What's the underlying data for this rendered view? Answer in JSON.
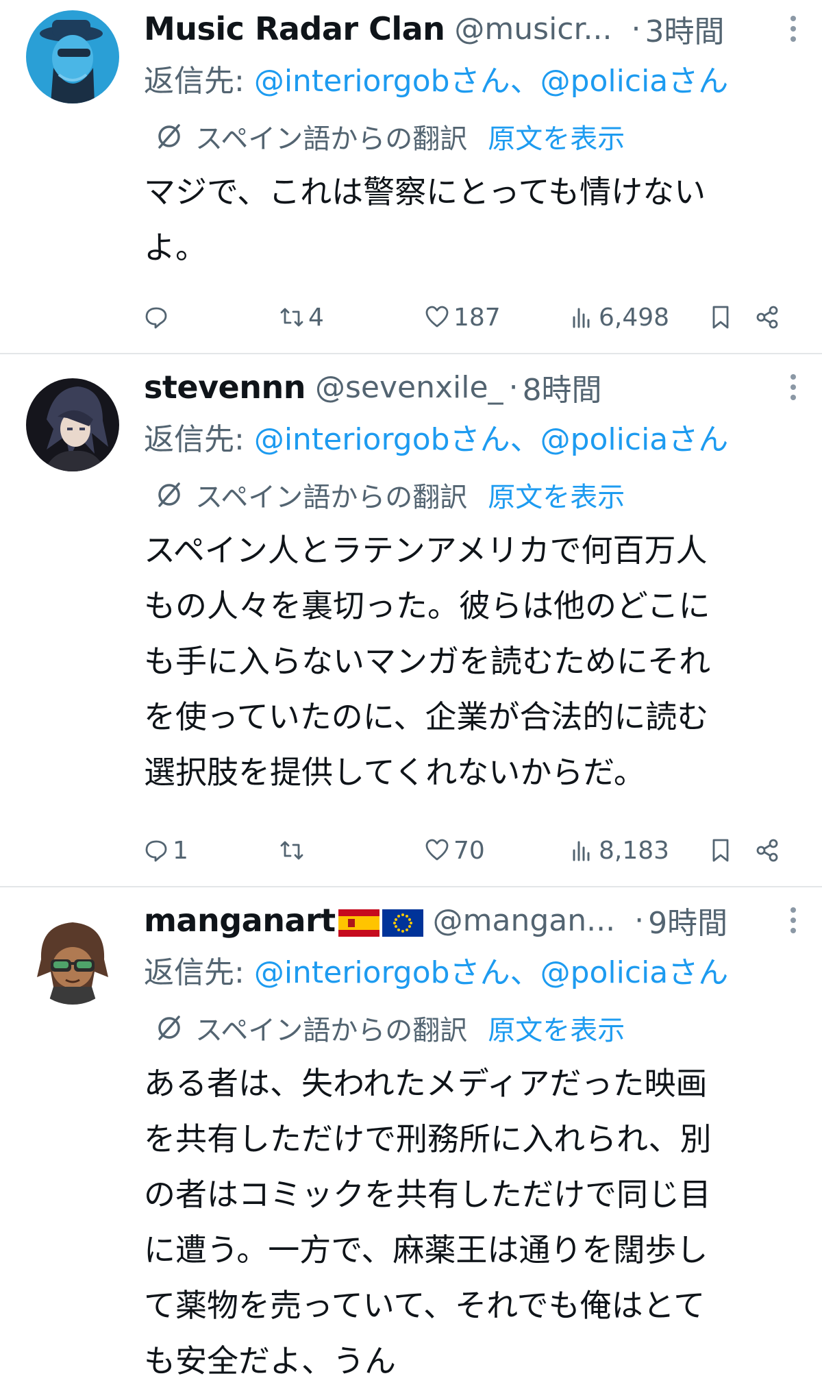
{
  "translation_label": "スペイン語からの翻訳",
  "show_original_label": "原文を表示",
  "tweets": [
    {
      "name": "Music Radar Clan",
      "handle": "@musicr...",
      "time": "3時間",
      "reply_prefix": "返信先: ",
      "reply_mentions": "@interiorgobさん、@policiaさん",
      "body": [
        "マジで、これは警察にとっても情けない",
        "よ。"
      ],
      "replies": "",
      "retweets": "4",
      "likes": "187",
      "views": "6,498"
    },
    {
      "name": "stevennn",
      "handle": "@sevenxile_",
      "time": "8時間",
      "reply_prefix": "返信先: ",
      "reply_mentions": "@interiorgobさん、@policiaさん",
      "body": [
        "スペイン人とラテンアメリカで何百万人",
        "もの人々を裏切った。彼らは他のどこに",
        "も手に入らないマンガを読むためにそれ",
        "を使っていたのに、企業が合法的に読む",
        "選択肢を提供してくれないからだ。"
      ],
      "replies": "1",
      "retweets": "",
      "likes": "70",
      "views": "8,183"
    },
    {
      "name": "manganart",
      "handle": "@mangan...",
      "time": "9時間",
      "reply_prefix": "返信先: ",
      "reply_mentions": "@interiorgobさん、@policiaさん",
      "body": [
        "ある者は、失われたメディアだった映画",
        "を共有しただけで刑務所に入れられ、別",
        "の者はコミックを共有しただけで同じ目",
        "に遭う。一方で、麻薬王は通りを闊歩し",
        "て薬物を売っていて、それでも俺はとて",
        "も安全だよ、うん"
      ],
      "replies": "",
      "retweets": "",
      "likes": "",
      "views": ""
    }
  ],
  "colors": {
    "link": "#1d9bf0",
    "muted": "#536471",
    "text": "#0f1419",
    "divider": "#e3e6e8"
  },
  "icons": [
    "reply-icon",
    "retweet-icon",
    "like-icon",
    "views-icon",
    "bookmark-icon",
    "share-icon",
    "translate-icon",
    "more-icon",
    "flag-spain-icon",
    "flag-eu-icon"
  ]
}
